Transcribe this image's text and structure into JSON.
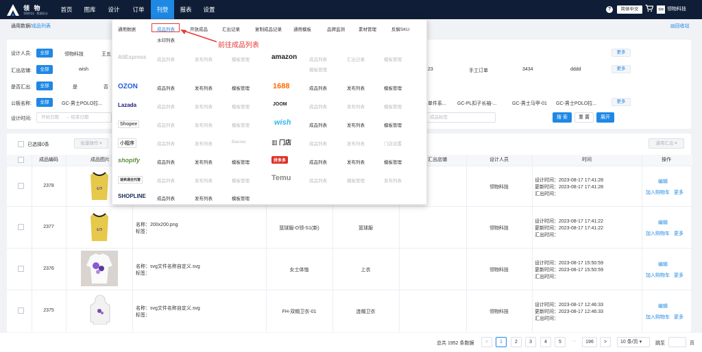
{
  "app": {
    "logo_title": "领 物",
    "logo_subtitle": "领物科技 · 数据驱动"
  },
  "nav": [
    {
      "label": "首页"
    },
    {
      "label": "图库"
    },
    {
      "label": "设计"
    },
    {
      "label": "订单"
    },
    {
      "label": "刊登"
    },
    {
      "label": "报表"
    },
    {
      "label": "设置"
    }
  ],
  "top_right": {
    "help": "?",
    "lang": "简体中文",
    "avatar": "领物",
    "user": "领物科技"
  },
  "breadcrumb": {
    "root": "通用数据/",
    "current": "成品列表"
  },
  "recycle": "回收站",
  "filters": {
    "designer": {
      "label": "设计人员:",
      "all": "全部",
      "options": [
        "领物科技",
        "王五"
      ],
      "more": "更多"
    },
    "store": {
      "label": "汇出店铺:",
      "all": "全部",
      "options": [
        "wish",
        "23",
        "手工订单",
        "3434",
        "dddd"
      ],
      "more": "更多"
    },
    "exported": {
      "label": "是否汇出:",
      "all": "全部",
      "options": [
        "是",
        "否"
      ]
    },
    "template": {
      "label": "公板名称:",
      "all": "全部",
      "options": [
        "GC-男士POLO拉...",
        "单件系...",
        "GC-PL扣子长袖-...",
        "GC-男士马甲-01",
        "GC-男士POLO拉..."
      ],
      "more": "更多"
    },
    "time": {
      "label": "设计时间:",
      "start": "开始日期",
      "sep": "→",
      "end": "结束日期",
      "tag_placeholder": "成品标签"
    },
    "buttons": {
      "search": "搜 索",
      "reset": "重 置",
      "expand": "展开"
    }
  },
  "toolbar": {
    "selected": "已选择0条",
    "batch": "批量操作",
    "export": "通用汇出"
  },
  "table": {
    "headers": [
      "成品编码",
      "成品图片",
      "",
      "",
      "",
      "汇出店铺",
      "设计人员",
      "时间",
      "操作"
    ],
    "rows": [
      {
        "code": "2378",
        "name": "",
        "tag": "",
        "model": "",
        "category": "",
        "designer": "领物科技",
        "design_time": "设计时间：2023-08-17 17:41:28",
        "update_time": "更新时间：2023-08-17 17:41:28",
        "export_time": "汇出时间：",
        "edit": "编辑",
        "cart": "加入购物车",
        "more": "更多"
      },
      {
        "code": "2377",
        "name": "名称：200x200.png",
        "tag": "标签：",
        "model": "篮球服-O领-S1(新)",
        "category": "篮球服",
        "designer": "领物科技",
        "design_time": "设计时间：2023-08-17 17:41:22",
        "update_time": "更新时间：2023-08-17 17:41:22",
        "export_time": "汇出时间：",
        "edit": "编辑",
        "cart": "加入购物车",
        "more": "更多"
      },
      {
        "code": "2376",
        "name": "名称：svg文件名称自定义.svg",
        "tag": "标签：",
        "model": "女士体恤",
        "category": "上衣",
        "designer": "领物科技",
        "design_time": "设计时间：2023-08-17 15:50:59",
        "update_time": "更新时间：2023-08-17 15:50:59",
        "export_time": "汇出时间：",
        "edit": "编辑",
        "cart": "加入购物车",
        "more": "更多"
      },
      {
        "code": "2375",
        "name": "名称：svg文件名称自定义.svg",
        "tag": "标签：",
        "model": "FH-双帽卫衣-01",
        "category": "连帽卫衣",
        "designer": "领物科技",
        "design_time": "设计时间：2023-08-17 12:46:33",
        "update_time": "更新时间：2023-08-17 12:46:33",
        "export_time": "汇出时间：",
        "edit": "编辑",
        "cart": "加入购物车",
        "more": "更多"
      }
    ]
  },
  "pager": {
    "total": "总共 1952 条数据",
    "prev": "<",
    "pages": [
      "1",
      "2",
      "3",
      "4",
      "5"
    ],
    "ellipsis": "···",
    "last": "196",
    "next": ">",
    "size": "10 条/页",
    "goto": "跳至",
    "goto_suffix": "页"
  },
  "menu": {
    "general": {
      "title": "通用数据",
      "items": [
        "成品列表",
        "开放成品",
        "汇出记录",
        "复制成品记录",
        "通用模板",
        "品牌监测",
        "素材管理",
        "反解SKU"
      ],
      "sub": "水印列表"
    },
    "platforms": [
      {
        "name": "AliExpress",
        "color": "#c7c7c7",
        "links": [
          "成品列表",
          "发布列表",
          "模板管理"
        ],
        "gray": true
      },
      {
        "name": "amazon",
        "color": "#222222",
        "links": [
          "成品列表",
          "汇出记录",
          "模板管理",
          "模板管理"
        ],
        "gray": true
      },
      {
        "name": "OZON",
        "color": "#1e5bd8",
        "links": [
          "成品列表",
          "发布列表",
          "模板管理"
        ],
        "gray": false
      },
      {
        "name": "1688",
        "color": "#ff6a00",
        "links": [
          "成品列表",
          "发布列表",
          "模板管理"
        ],
        "gray": false
      },
      {
        "name": "Lazada",
        "color": "#1a1a7a",
        "links": [
          "成品列表",
          "发布列表",
          "模板管理"
        ],
        "gray": true
      },
      {
        "name": "JOOM",
        "color": "#222222",
        "links": [
          "成品列表",
          "发布列表",
          "模板管理"
        ],
        "gray": true
      },
      {
        "name": "Shopee",
        "color": "#555555",
        "links": [
          "成品列表",
          "发布列表",
          "模板管理"
        ],
        "gray": true
      },
      {
        "name": "wish",
        "color": "#2fb7ec",
        "links": [
          "成品列表",
          "发布列表",
          "模板管理"
        ],
        "gray": false
      },
      {
        "name": "小程序",
        "color": "#555555",
        "links": [
          "成品列表",
          "发布列表",
          "Banner"
        ],
        "gray": true
      },
      {
        "name": "门店",
        "color": "#333333",
        "links": [
          "成品列表",
          "发布列表",
          "门店设置"
        ],
        "gray": true
      },
      {
        "name": "shopify",
        "color": "#5e8e3e",
        "links": [
          "成品列表",
          "发布列表",
          "模板管理"
        ],
        "gray": false
      },
      {
        "name": "拼多多",
        "color": "#e02e24",
        "links": [
          "成品列表",
          "发布列表",
          "模板管理"
        ],
        "gray": false
      },
      {
        "name": "速卖通全托管",
        "color": "#333333",
        "links": [
          "成品列表",
          "发布列表",
          "模板管理"
        ],
        "gray": true
      },
      {
        "name": "Temu",
        "color": "#888888",
        "links": [
          "成品列表",
          "模板管理",
          "发布列表"
        ],
        "gray": true
      },
      {
        "name": "SHOPLINE",
        "color": "#1a2b55",
        "links": [
          "成品列表",
          "发布列表",
          "模板管理"
        ],
        "gray": false
      }
    ]
  },
  "annotation": "前往成品列表"
}
